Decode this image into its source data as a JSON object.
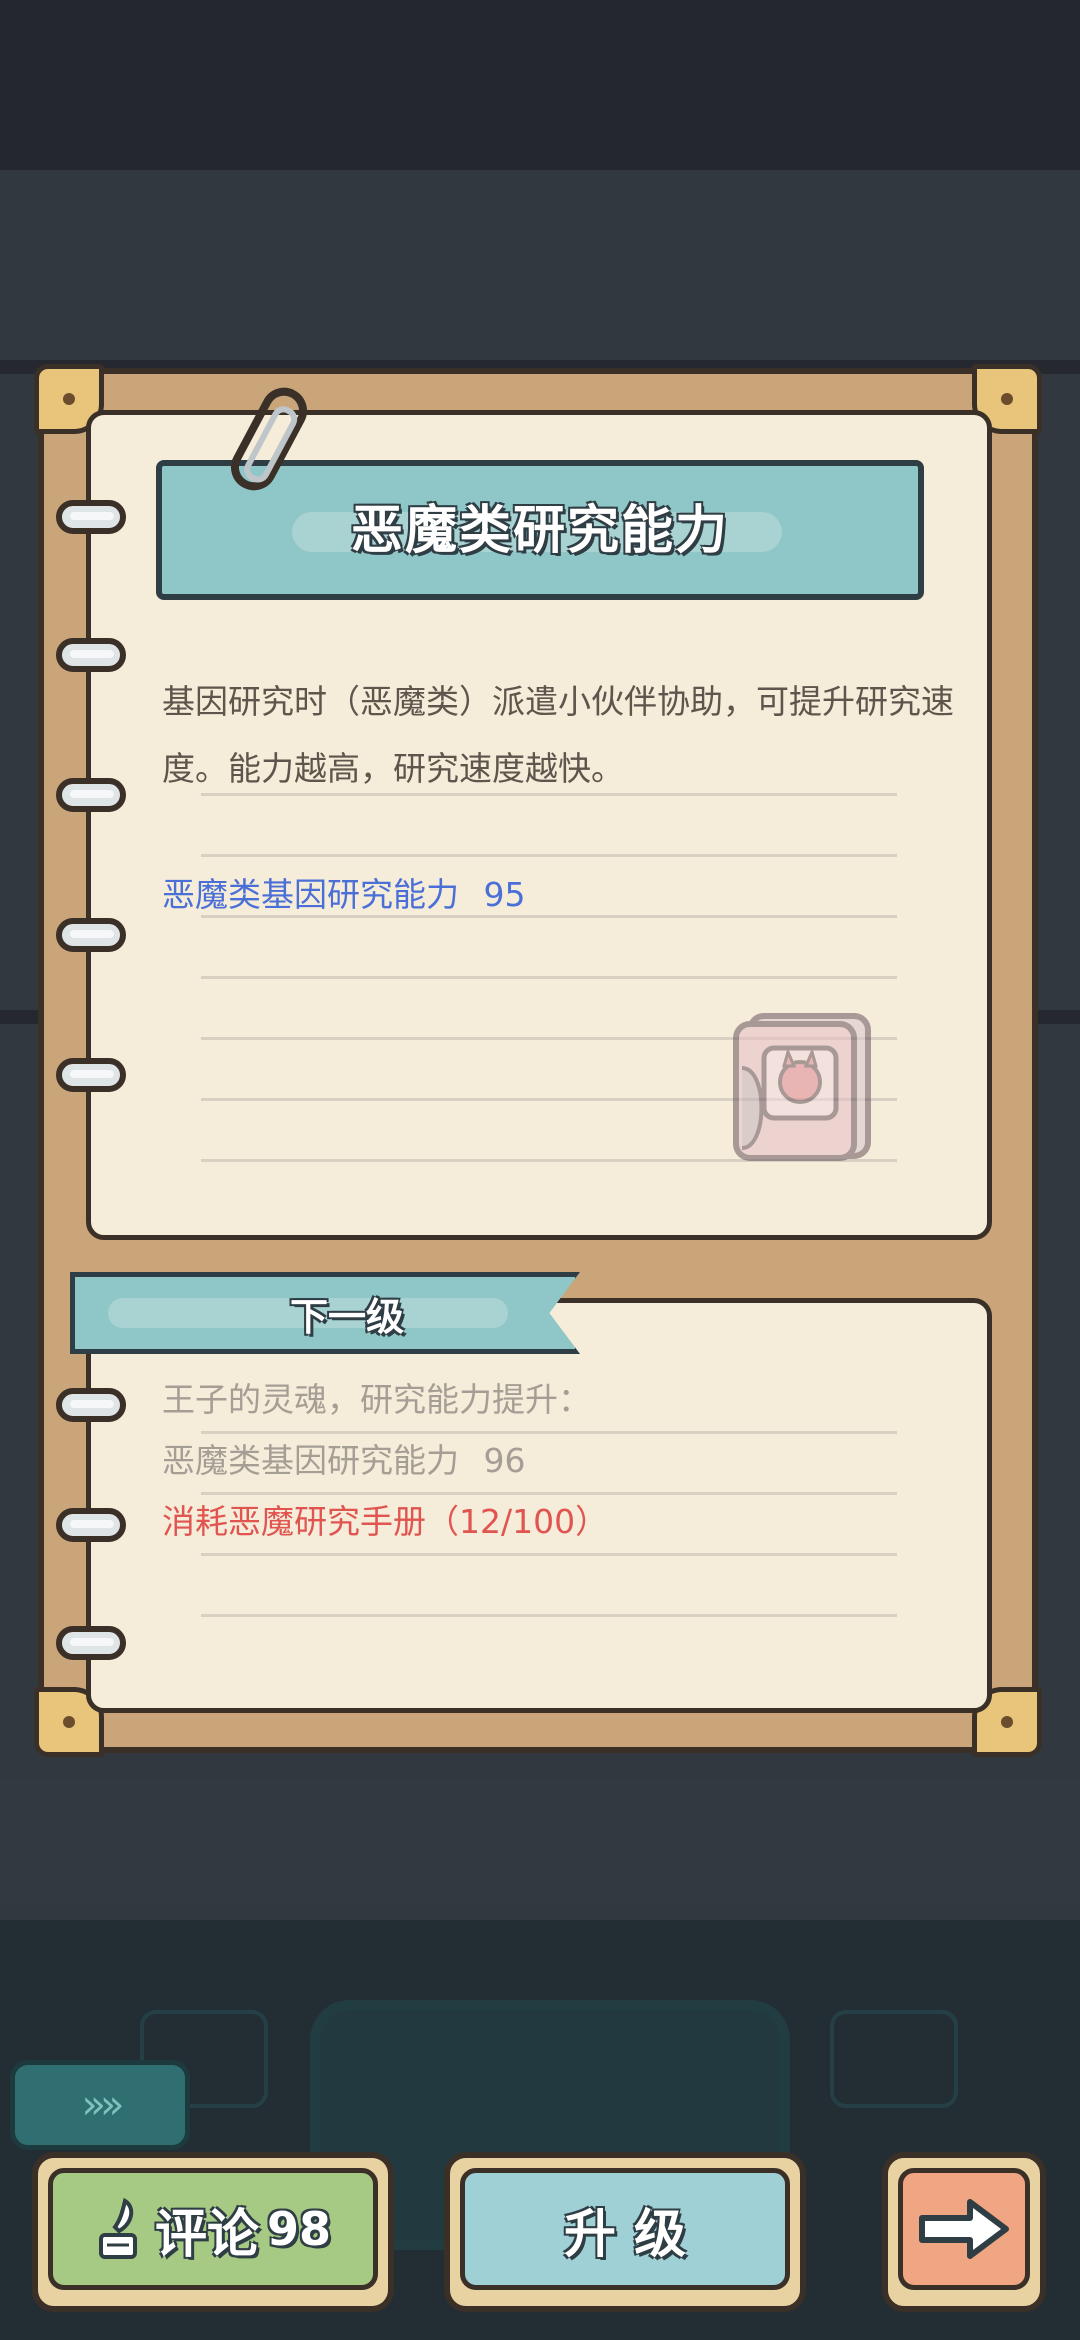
{
  "card": {
    "title": "恶魔类研究能力",
    "description": "基因研究时（恶魔类）派遣小伙伴协助，可提升研究速度。能力越高，研究速度越快。",
    "stat": {
      "label": "恶魔类基因研究能力",
      "value": "95"
    },
    "icon": "demon-research-book-icon"
  },
  "next_level": {
    "title": "下一级",
    "line1": "王子的灵魂，研究能力提升：",
    "line2": {
      "label": "恶魔类基因研究能力",
      "value": "96"
    },
    "cost": "消耗恶魔研究手册（12/100）"
  },
  "buttons": {
    "comment": {
      "label": "评论",
      "count": "98",
      "icon": "quill-icon"
    },
    "upgrade": {
      "label": "升 级"
    },
    "next": {
      "icon": "arrow-right-icon"
    }
  },
  "side_tab": {
    "icon": "chevrons-right-icon",
    "text": "»»"
  },
  "colors": {
    "ribbon": "#8fc6c7",
    "stat_blue": "#4a6fd6",
    "cost_red": "#e05550",
    "page": "#f5ecd9",
    "comment_green": "#a6c983",
    "next_orange": "#f0a683"
  }
}
